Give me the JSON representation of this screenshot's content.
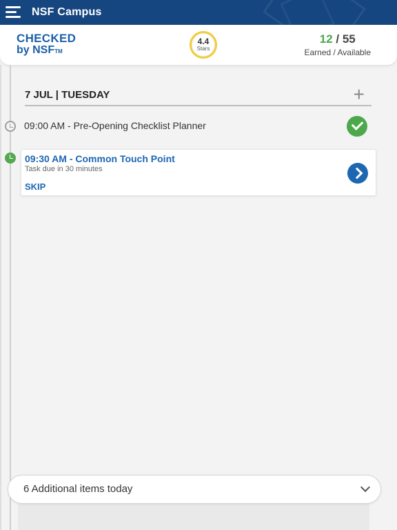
{
  "app": {
    "title": "NSF Campus"
  },
  "header": {
    "logo_line1": "CHECKED",
    "logo_line2": "by NSF",
    "logo_tm": "TM",
    "stars_value": "4.4",
    "stars_label": "Stars",
    "earned": "12",
    "separator": " / ",
    "available": "55",
    "sub_label": "Earned / Available"
  },
  "day": {
    "date_label": "7 JUL | TUESDAY",
    "add_icon": "plus-icon"
  },
  "tasks": [
    {
      "text": "09:00 AM - Pre-Opening Checklist Planner",
      "status": "completed"
    },
    {
      "title": "09:30 AM - Common Touch Point",
      "subtitle": "Task due in 30 minutes",
      "skip_label": "SKIP",
      "status": "due"
    }
  ],
  "footer": {
    "more_label": "6 Additional items today"
  },
  "colors": {
    "brand": "#16467f",
    "accent_blue": "#1d66b2",
    "success": "#4ca84a",
    "star_ring": "#f2cc39"
  }
}
